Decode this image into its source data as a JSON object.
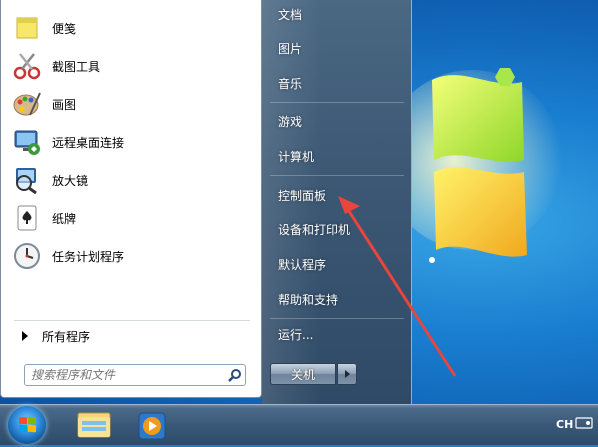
{
  "left_programs": [
    {
      "label": "便笺",
      "icon": "sticky-notes-icon"
    },
    {
      "label": "截图工具",
      "icon": "snipping-tool-icon"
    },
    {
      "label": "画图",
      "icon": "paint-icon"
    },
    {
      "label": "远程桌面连接",
      "icon": "remote-desktop-icon"
    },
    {
      "label": "放大镜",
      "icon": "magnifier-icon"
    },
    {
      "label": "纸牌",
      "icon": "solitaire-icon"
    },
    {
      "label": "任务计划程序",
      "icon": "task-scheduler-icon"
    }
  ],
  "all_programs_label": "所有程序",
  "search": {
    "placeholder": "搜索程序和文件"
  },
  "right_items": [
    {
      "label": "文档"
    },
    {
      "label": "图片"
    },
    {
      "label": "音乐"
    },
    {
      "label": "游戏"
    },
    {
      "label": "计算机"
    },
    {
      "label": "控制面板"
    },
    {
      "label": "设备和打印机"
    },
    {
      "label": "默认程序"
    },
    {
      "label": "帮助和支持"
    },
    {
      "label": "运行..."
    }
  ],
  "shutdown_label": "关机",
  "taskbar": {
    "language": "CH",
    "pinned": [
      "windows-explorer-icon",
      "media-player-icon"
    ]
  },
  "colors": {
    "annotation_arrow": "#e8453c",
    "accent": "#2c88d8"
  }
}
